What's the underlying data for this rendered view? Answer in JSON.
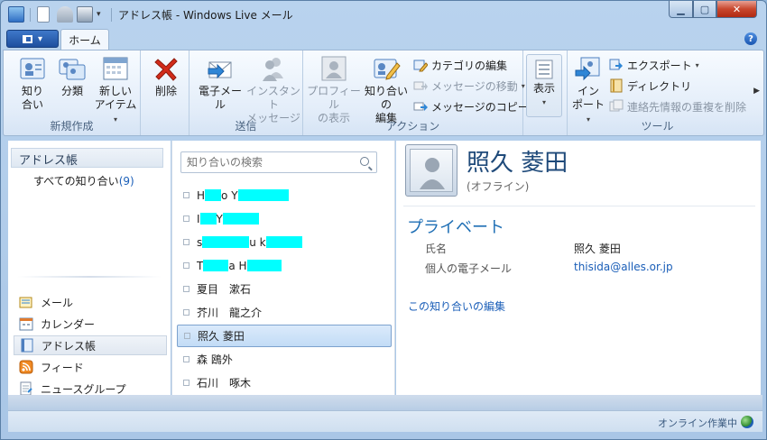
{
  "window": {
    "title": "アドレス帳 - Windows Live メール"
  },
  "colors": {
    "accent": "#1f6fb5",
    "selection": "#c2dcf6",
    "mask": "#00ffff"
  },
  "ribbon": {
    "tab": "ホーム",
    "groups": {
      "new": "新規作成",
      "send": "送信",
      "action": "アクション",
      "tools": "ツール"
    },
    "contact": [
      "知り",
      "合い"
    ],
    "category": "分類",
    "newitem": [
      "新しい",
      "アイテム"
    ],
    "delete": "削除",
    "email": "電子メール",
    "im": [
      "インスタント",
      "メッセージ"
    ],
    "viewprofile": [
      "プロフィール",
      "の表示"
    ],
    "editcontact": [
      "知り合いの",
      "編集"
    ],
    "editcategory": "カテゴリの編集",
    "movemsg": "メッセージの移動",
    "copymsg": "メッセージのコピー",
    "view": "表示",
    "import": [
      "イン",
      "ポート"
    ],
    "export": "エクスポート",
    "directory": "ディレクトリ",
    "dedupe": "連絡先情報の重複を削除"
  },
  "nav": {
    "header": "アドレス帳",
    "all_label": "すべての知り合い",
    "all_count": "(9)",
    "items": [
      "メール",
      "カレンダー",
      "アドレス帳",
      "フィード",
      "ニュースグループ"
    ]
  },
  "search": {
    "placeholder": "知り合いの検索"
  },
  "contacts": [
    {
      "a": "H",
      "b": "o Y",
      "c": ""
    },
    {
      "a": "I",
      "b": " Y",
      "c": ""
    },
    {
      "a": "s",
      "b": "u k",
      "c": ""
    },
    {
      "a": "T",
      "b": "a H",
      "c": ""
    },
    {
      "name": "夏目　漱石"
    },
    {
      "name": "芥川　龍之介"
    },
    {
      "name": "照久 菱田"
    },
    {
      "name": "森 鴎外"
    },
    {
      "name": "石川　啄木"
    }
  ],
  "detail": {
    "name": "照久 菱田",
    "status": "(オフライン)",
    "section": "プライベート",
    "name_label": "氏名",
    "name_value": "照久 菱田",
    "email_label": "個人の電子メール",
    "email_value": "thisida@alles.or.jp",
    "edit_link": "この知り合いの編集"
  },
  "statusbar": {
    "text": "オンライン作業中"
  }
}
